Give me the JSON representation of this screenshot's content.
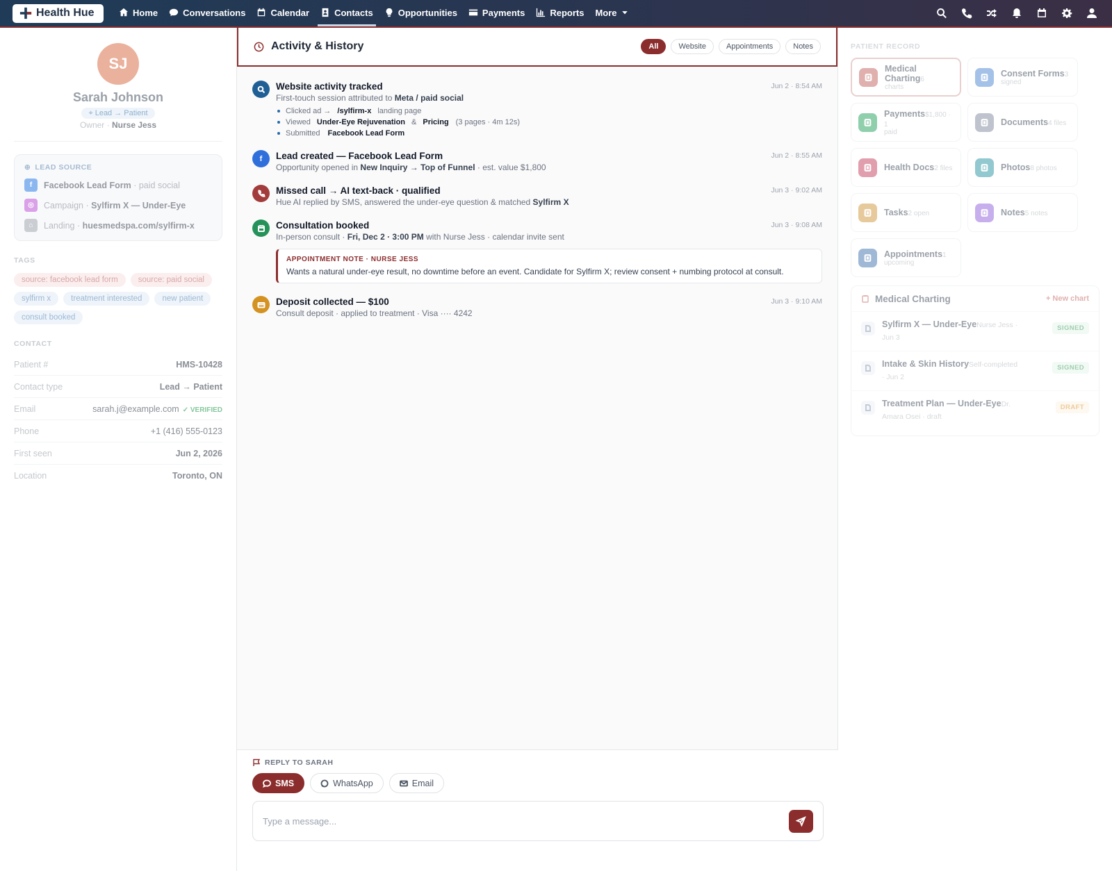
{
  "nav": {
    "brand": "Health Hue",
    "items": [
      {
        "label": "Home",
        "icon": "home-icon"
      },
      {
        "label": "Conversations",
        "icon": "chat-icon"
      },
      {
        "label": "Calendar",
        "icon": "calendar-icon"
      },
      {
        "label": "Contacts",
        "icon": "contacts-icon",
        "active": true
      },
      {
        "label": "Opportunities",
        "icon": "lightbulb-icon"
      },
      {
        "label": "Payments",
        "icon": "card-icon"
      },
      {
        "label": "Reports",
        "icon": "chart-icon"
      },
      {
        "label": "More",
        "icon": "caret-down-icon"
      }
    ],
    "right_icons": [
      "search-icon",
      "phone-icon",
      "shuffle-icon",
      "bell-icon",
      "calendar-icon",
      "gear-icon",
      "user-icon"
    ]
  },
  "profile": {
    "initials": "SJ",
    "name": "Sarah Johnson",
    "status": "Lead → Patient",
    "owner_label": "Owner ·",
    "owner": "Nurse Jess"
  },
  "lead_source": {
    "heading": "LEAD SOURCE",
    "rows": [
      {
        "strong": "Facebook Lead Form",
        "muted": " · paid social",
        "icon": "facebook-icon",
        "color": "#7fb0ef"
      },
      {
        "prefix": "Campaign · ",
        "strong": "Sylfirm X — Under-Eye",
        "icon": "instagram-icon",
        "color": "#d796e6"
      },
      {
        "prefix": "Landing · ",
        "strong": "huesmedspa.com/sylfirm-x",
        "icon": "globe-icon",
        "color": "#c5c9ce"
      }
    ]
  },
  "tags": {
    "heading": "TAGS",
    "items": [
      {
        "label": "source: facebook lead form",
        "tone": "red"
      },
      {
        "label": "source: paid social",
        "tone": "red"
      },
      {
        "label": "sylfirm x",
        "tone": "blue"
      },
      {
        "label": "treatment interested",
        "tone": "blue"
      },
      {
        "label": "new patient",
        "tone": "blue"
      },
      {
        "label": "consult booked",
        "tone": "blue"
      }
    ]
  },
  "contact": {
    "heading": "CONTACT",
    "rows": [
      {
        "key": "Patient #",
        "value": "HMS-10428"
      },
      {
        "key": "Contact type",
        "value": "Lead → Patient"
      },
      {
        "key": "Email",
        "value": "sarah.j@example.com",
        "verified": "✓ VERIFIED"
      },
      {
        "key": "Phone",
        "value": "+1 (416) 555-0123"
      },
      {
        "key": "First seen",
        "value": "Jun 2, 2026"
      },
      {
        "key": "Location",
        "value": "Toronto, ON"
      }
    ]
  },
  "activity": {
    "title": "Activity & History",
    "filters": [
      {
        "label": "All",
        "active": true
      },
      {
        "label": "Website"
      },
      {
        "label": "Appointments"
      },
      {
        "label": "Notes"
      }
    ],
    "events": {
      "e1": {
        "title": "Website activity tracked",
        "time": "Jun 2 · 8:54 AM",
        "sub_a": "First-touch session attributed to ",
        "sub_b": "Meta / paid social",
        "color": "#1f5f95",
        "b1_a": "Clicked ad →",
        "b1_b": "/sylfirm-x",
        "b1_c": "landing page",
        "b2_a": "Viewed",
        "b2_b": "Under-Eye Rejuvenation",
        "b2_c": "&",
        "b2_d": "Pricing",
        "b2_e": "(3 pages · 4m 12s)",
        "b3_a": "Submitted",
        "b3_b": "Facebook Lead Form"
      },
      "e2": {
        "title": "Lead created — Facebook Lead Form",
        "time": "Jun 2 · 8:55 AM",
        "sub_a": "Opportunity opened in ",
        "sub_b": "New Inquiry → Top of Funnel",
        "sub_c": " · est. value $1,800",
        "color": "#2f6fdc"
      },
      "e3": {
        "title": "Missed call → AI text-back · qualified",
        "time": "Jun 3 · 9:02 AM",
        "sub_a": "Hue AI replied by SMS, answered the under-eye question & matched ",
        "sub_b": "Sylfirm X",
        "color": "#a23c3c"
      },
      "e4": {
        "title": "Consultation booked",
        "time": "Jun 3 · 9:08 AM",
        "sub_a": "In-person consult · ",
        "sub_b": "Fri, Dec 2 · 3:00 PM",
        "sub_c": " with Nurse Jess · calendar invite sent",
        "color": "#25925a",
        "note_head": "APPOINTMENT NOTE · NURSE JESS",
        "note_body": "Wants a natural under-eye result, no downtime before an event. Candidate for Sylfirm X; review consent + numbing protocol at consult."
      },
      "e5": {
        "title": "Deposit collected — $100",
        "time": "Jun 3 · 9:10 AM",
        "sub_a": "Consult deposit · applied to treatment · Visa ···· 4242",
        "color": "#d49222"
      }
    }
  },
  "reply": {
    "label": "REPLY TO SARAH",
    "channels": [
      {
        "label": "SMS",
        "active": true
      },
      {
        "label": "WhatsApp"
      },
      {
        "label": "Email"
      }
    ],
    "placeholder": "Type a message..."
  },
  "record": {
    "heading": "PATIENT RECORD",
    "cards": [
      {
        "title": "Medical Charting",
        "count": "6",
        "sub": "charts",
        "color": "#c5706b",
        "selected": true
      },
      {
        "title": "Consent Forms",
        "count": "3",
        "sub": "signed",
        "color": "#5b8fd6"
      },
      {
        "title": "Payments",
        "count": "$1,800 · 1",
        "sub": "paid",
        "color": "#36a86a"
      },
      {
        "title": "Documents",
        "count": "4 files",
        "sub": "",
        "color": "#8a93a5"
      },
      {
        "title": "Health Docs",
        "count": "2 files",
        "sub": "",
        "color": "#c9506b"
      },
      {
        "title": "Photos",
        "count": "8 photos",
        "sub": "",
        "color": "#3a9ca8"
      },
      {
        "title": "Tasks",
        "count": "2 open",
        "sub": "",
        "color": "#d4a04c"
      },
      {
        "title": "Notes",
        "count": "5 notes",
        "sub": "",
        "color": "#9b6fe0"
      },
      {
        "title": "Appointments",
        "count": "1",
        "sub": "upcoming",
        "color": "#4f7fb5"
      }
    ],
    "charting": {
      "title": "Medical Charting",
      "new": "+ New chart",
      "rows": [
        {
          "title": "Sylfirm X — Under-Eye",
          "meta1": "Nurse Jess ·",
          "meta2": "Jun 3",
          "badge": "SIGNED",
          "tone": "signed"
        },
        {
          "title": "Intake & Skin History",
          "meta1": "Self-completed",
          "meta2": "· Jun 2",
          "badge": "SIGNED",
          "tone": "signed"
        },
        {
          "title": "Treatment Plan — Under-Eye",
          "meta1": "Dr.",
          "meta2": "Amara Osei · draft",
          "badge": "DRAFT",
          "tone": "draft"
        }
      ]
    }
  }
}
